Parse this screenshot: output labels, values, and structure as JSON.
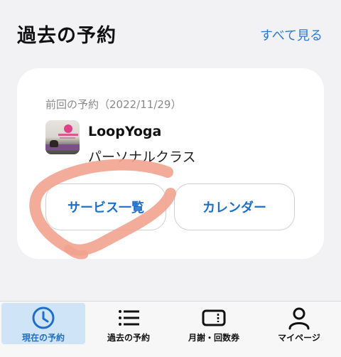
{
  "header": {
    "title": "過去の予約",
    "see_all": "すべて見る"
  },
  "card": {
    "previous_label": "前回の予約（2022/11/29）",
    "shop_name": "LoopYoga",
    "class_name": "パーソナルクラス",
    "buttons": {
      "services": "サービス一覧",
      "calendar": "カレンダー"
    }
  },
  "tabs": [
    {
      "label": "現在の予約",
      "icon": "clock-icon",
      "active": true
    },
    {
      "label": "過去の予約",
      "icon": "list-icon",
      "active": false
    },
    {
      "label": "月謝・回数券",
      "icon": "ticket-icon",
      "active": false
    },
    {
      "label": "マイページ",
      "icon": "person-icon",
      "active": false
    }
  ],
  "colors": {
    "accent": "#1f6fc8",
    "link": "#2a7bd6",
    "active_tab_bg": "#cfe5f7",
    "highlight_scribble": "#f2a28f"
  }
}
